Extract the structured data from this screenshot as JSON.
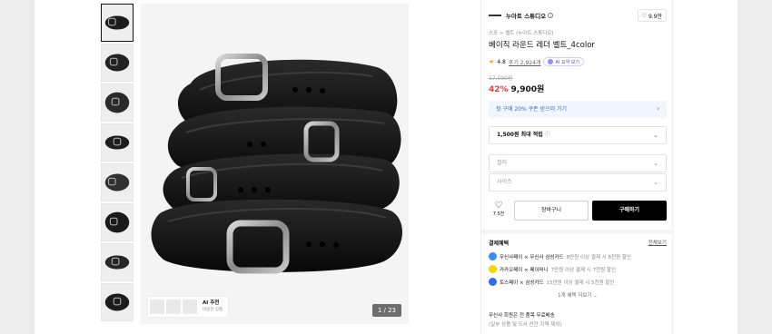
{
  "thumbnails": [
    {
      "name": "thumb-1",
      "active": true
    },
    {
      "name": "thumb-2",
      "active": false
    },
    {
      "name": "thumb-3",
      "active": false
    },
    {
      "name": "thumb-4",
      "active": false
    },
    {
      "name": "thumb-5",
      "active": false
    },
    {
      "name": "thumb-6",
      "active": false
    },
    {
      "name": "thumb-7",
      "active": false
    },
    {
      "name": "thumb-8",
      "active": false
    }
  ],
  "gallery": {
    "counter": "1 / 23",
    "ai_recommend_label": "AI 추천",
    "ai_recommend_sub": "비슷한 상품"
  },
  "product": {
    "brand": "누아트 스튜디오",
    "likes": "9.9만",
    "breadcrumb": "스포 > 벨트 (누아트 스튜디오)",
    "title": "베이직 라운드 레더 벨트_4color",
    "rating": "4.8",
    "reviews": "후기 2,924개",
    "ai_summary": "AI 요약 보기",
    "original_price": "17,000원",
    "discount": "42%",
    "price": "9,900원"
  },
  "coupon": {
    "text": "첫 구매 20% 쿠폰 받으러 가기"
  },
  "points": {
    "bold": "1,500원 최대 적립",
    "icon": "info-icon"
  },
  "options": {
    "color_placeholder": "컬러",
    "size_placeholder": "사이즈"
  },
  "actions": {
    "wish_count": "7.5천",
    "cart": "장바구니",
    "buy": "구매하기"
  },
  "benefits": {
    "title": "결제혜택",
    "see_all": "전체보기",
    "items": [
      {
        "label": "무신사페이 × 무신사 삼성카드",
        "detail": "8만원 이상 결제 시 8천원 할인",
        "color": "#3d8bf0"
      },
      {
        "label": "카카오페이 × 페이머니",
        "detail": "7만원 이상 결제 시 7천원 할인",
        "color": "#f7d300"
      },
      {
        "label": "토스페이 × 삼성카드",
        "detail": "15만원 이상 결제 시 5천원 할인",
        "color": "#2b6ff0"
      }
    ],
    "more": "1개 혜택 더보기"
  },
  "shipping": {
    "line1": "무신사 회원은 전 품목 무료배송",
    "line2": "(일부 상품 및 도서 산간 지역 제외)"
  }
}
